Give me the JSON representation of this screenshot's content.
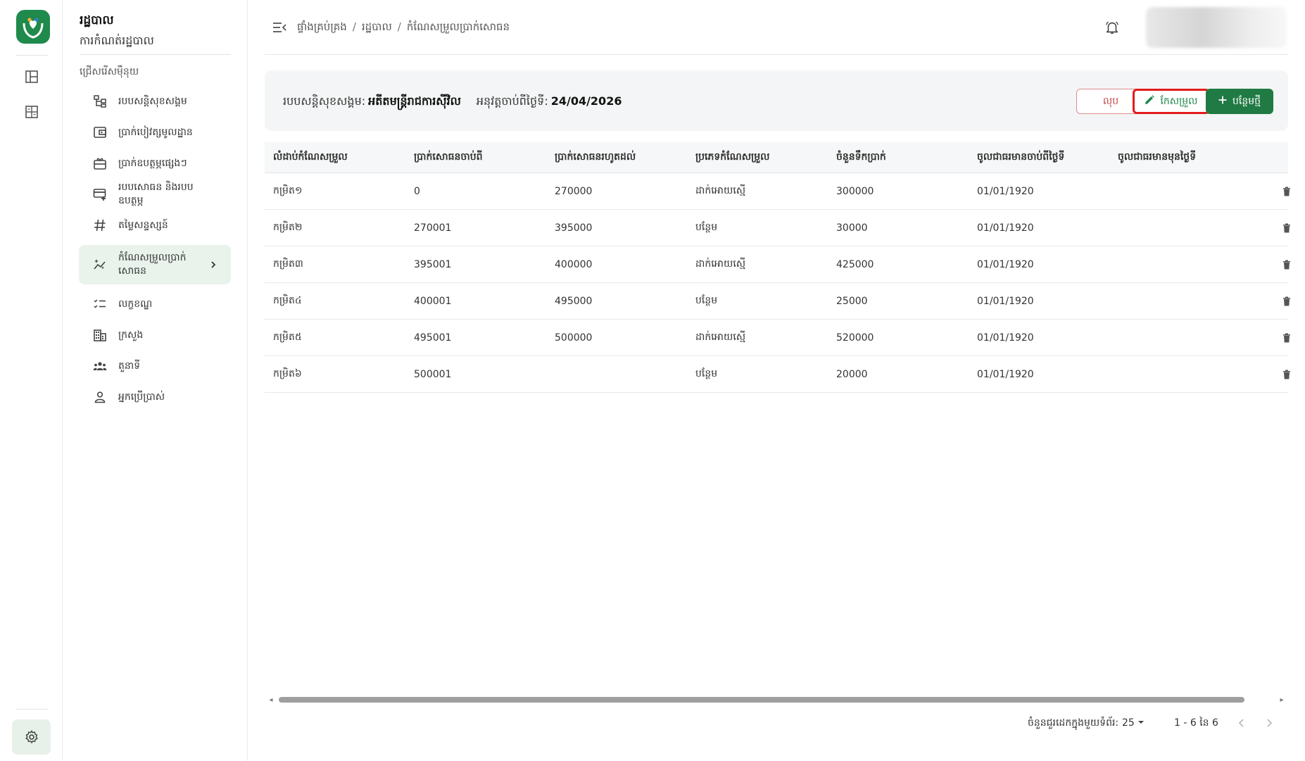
{
  "app": {
    "title": "រដ្ឋបាល",
    "subtitle": "ការកំណត់រដ្ឋបាល",
    "brand_color": "#1f8a4c"
  },
  "sidebar": {
    "section_label": "ជ្រើសរើសម៉ឺនុយ",
    "items": [
      {
        "label": "របបសន្តិសុខសង្គម",
        "icon": "hierarchy-icon"
      },
      {
        "label": "ប្រាក់បៀវត្សមូលដ្ឋាន",
        "icon": "wallet-icon"
      },
      {
        "label": "ប្រាក់ឧបត្ថម្ភផ្សេងៗ",
        "icon": "gift-icon"
      },
      {
        "label": "របបសោធន និងរបបឧបត្ថម្ភ",
        "icon": "card-add-icon"
      },
      {
        "label": "តម្លៃសន្ទស្សន៍",
        "icon": "hash-icon"
      },
      {
        "label": "កំណែសម្រួលប្រាក់សោធន",
        "icon": "sparkle-chart-icon",
        "active": true
      },
      {
        "label": "លក្ខខណ្ឌ",
        "icon": "checklist-icon"
      },
      {
        "label": "ក្រសួង",
        "icon": "building-icon"
      },
      {
        "label": "តួនាទី",
        "icon": "group-icon"
      },
      {
        "label": "អ្នកប្រើប្រាស់",
        "icon": "user-icon"
      }
    ]
  },
  "header": {
    "breadcrumb": [
      "ផ្ទាំងគ្រប់គ្រង",
      "រដ្ឋបាល",
      "កំណែសម្រួលប្រាក់សោធន"
    ],
    "separator": "/"
  },
  "infobar": {
    "scheme_label": "របបសន្តិសុខសង្គម:",
    "scheme_value": "អតីតមន្ត្រីរាជការស៊ីវិល",
    "effective_label": "អនុវត្តចាប់ពីថ្ងៃទី:",
    "effective_value": "24/04/2026",
    "delete_label": "លុប",
    "edit_label": "កែសម្រួល",
    "add_label": "បន្ថែមថ្មី"
  },
  "table": {
    "columns": [
      "លំដាប់កំណែសម្រួល",
      "ប្រាក់សោធនចាប់ពី",
      "ប្រាក់សោធនរហូតដល់",
      "ប្រភេទកំណែសម្រួល",
      "ចំនួនទឹកប្រាក់",
      "ចូលជាធរមានចាប់ពីថ្ងៃទី",
      "ចូលជាធរមានមុនថ្ងៃទី"
    ],
    "rows": [
      [
        "កម្រិត១",
        "0",
        "270000",
        "ដាក់អោយស្មើ",
        "300000",
        "01/01/1920",
        ""
      ],
      [
        "កម្រិត២",
        "270001",
        "395000",
        "បន្ថែម",
        "30000",
        "01/01/1920",
        ""
      ],
      [
        "កម្រិត៣",
        "395001",
        "400000",
        "ដាក់អោយស្មើ",
        "425000",
        "01/01/1920",
        ""
      ],
      [
        "កម្រិត៤",
        "400001",
        "495000",
        "បន្ថែម",
        "25000",
        "01/01/1920",
        ""
      ],
      [
        "កម្រិត៥",
        "495001",
        "500000",
        "ដាក់អោយស្មើ",
        "520000",
        "01/01/1920",
        ""
      ],
      [
        "កម្រិត៦",
        "500001",
        "",
        "បន្ថែម",
        "20000",
        "01/01/1920",
        ""
      ]
    ]
  },
  "pagination": {
    "rows_per_page_label": "ចំនួនជួរដេកក្នុងមួយទំព័រ:",
    "rows_per_page": "25",
    "range": "1 - 6 នៃ 6"
  }
}
